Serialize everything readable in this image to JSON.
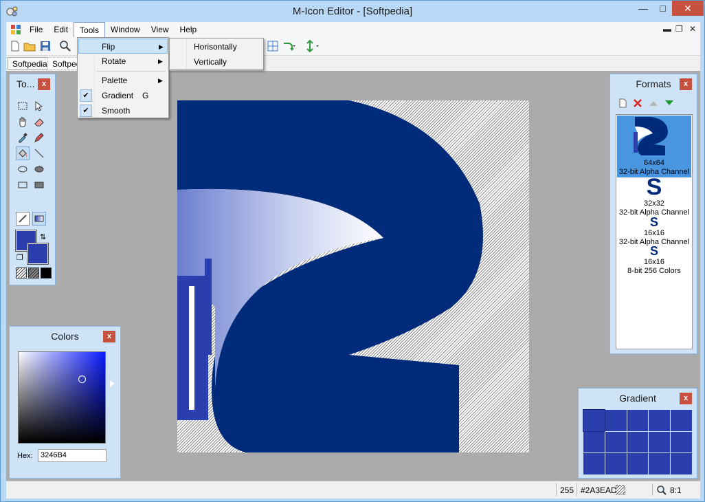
{
  "window": {
    "title": "M-Icon Editor - [Softpedia]"
  },
  "menubar": {
    "items": [
      "File",
      "Edit",
      "Tools",
      "Window",
      "View",
      "Help"
    ]
  },
  "doc_tabs": [
    "Softpedia",
    "Softped"
  ],
  "tools_menu": {
    "items": [
      {
        "label": "Flip",
        "has_submenu": true
      },
      {
        "label": "Rotate",
        "has_submenu": true
      },
      {
        "label": "Palette",
        "has_submenu": true
      },
      {
        "label": "Gradient",
        "shortcut": "G",
        "checked": true
      },
      {
        "label": "Smooth",
        "checked": true
      }
    ]
  },
  "flip_submenu": {
    "items": [
      "Horisontally",
      "Vertically"
    ]
  },
  "tools_panel": {
    "title": "To..."
  },
  "colors_panel": {
    "title": "Colors",
    "hex_label": "Hex:",
    "hex_value": "3246B4",
    "primary_color": "#2A3EAD",
    "secondary_color": "#2A3EAD"
  },
  "formats_panel": {
    "title": "Formats",
    "items": [
      {
        "size": "64x64",
        "depth": "32-bit Alpha Channel",
        "selected": true
      },
      {
        "size": "32x32",
        "depth": "32-bit Alpha Channel",
        "selected": false
      },
      {
        "size": "16x16",
        "depth": "32-bit Alpha Channel",
        "selected": false
      },
      {
        "size": "16x16",
        "depth": "8-bit 256 Colors",
        "selected": false
      }
    ]
  },
  "gradient_panel": {
    "title": "Gradient"
  },
  "statusbar": {
    "value": "255",
    "color": "#2A3EAD",
    "zoom": "8:1"
  },
  "colors": {
    "icon_blue": "#002a7a",
    "paint_blue": "#2A3EAD",
    "titlebar": "#b9d8f5",
    "workspace": "#ababab"
  }
}
